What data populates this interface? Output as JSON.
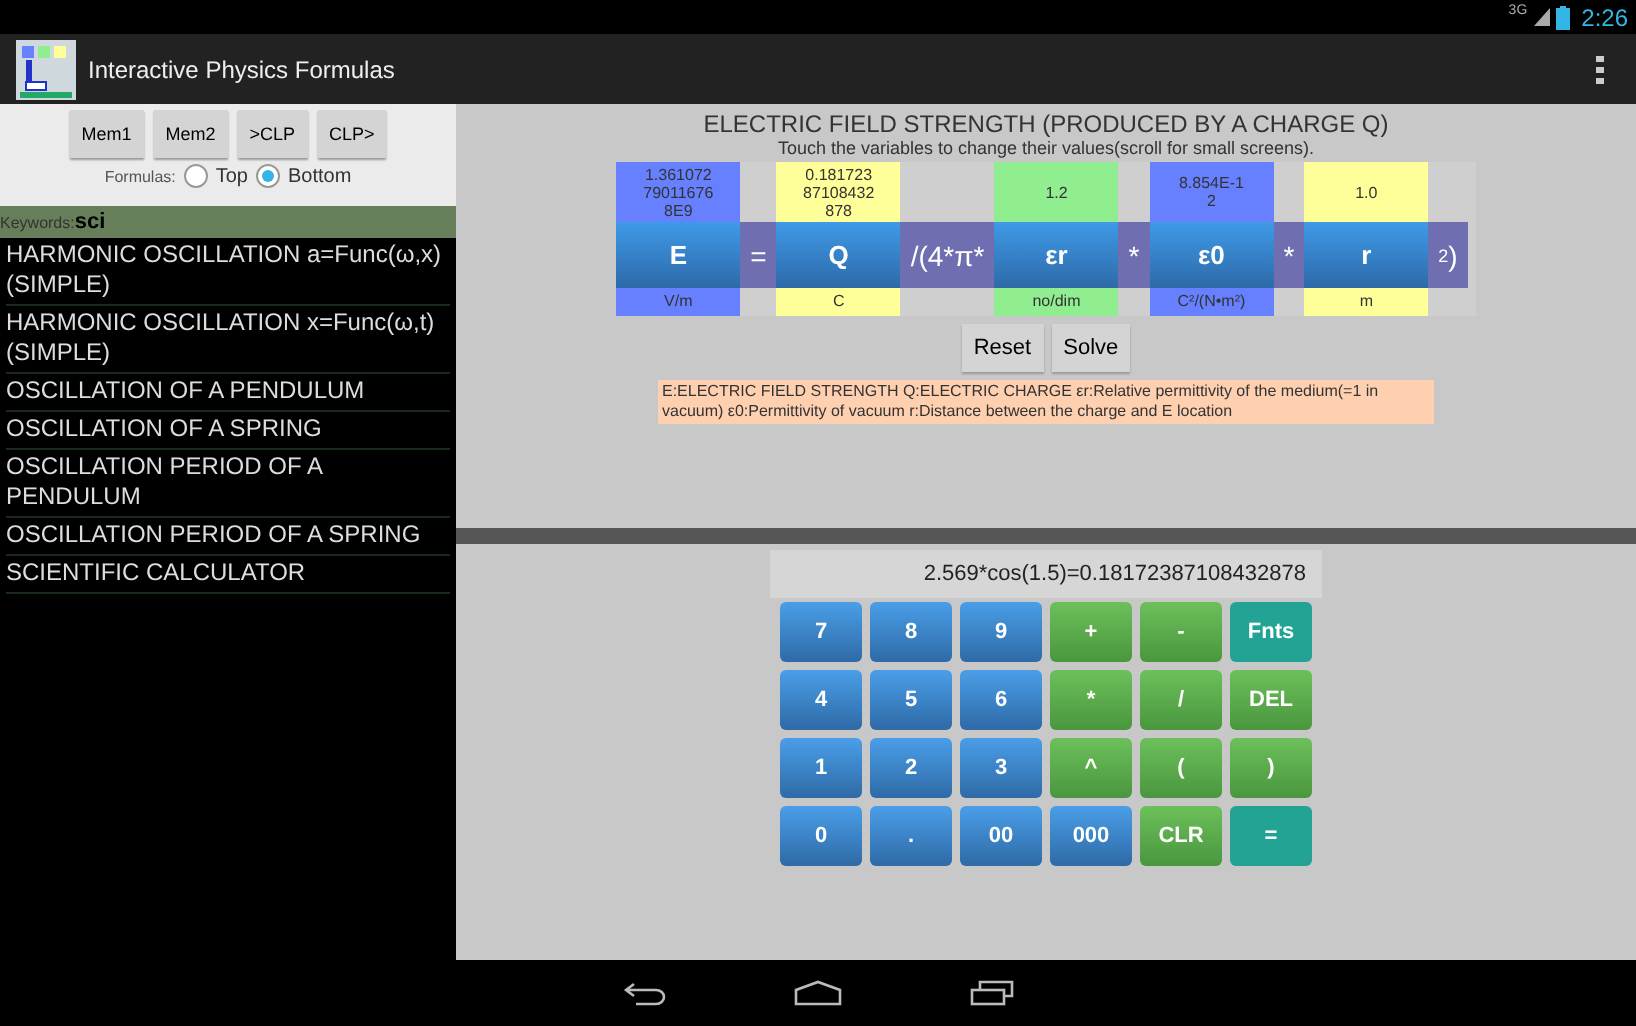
{
  "status_bar": {
    "signal": "3G",
    "time": "2:26"
  },
  "app_bar": {
    "title": "Interactive Physics Formulas"
  },
  "memory_buttons": [
    "Mem1",
    "Mem2",
    ">CLP",
    "CLP>"
  ],
  "formulas_position": {
    "label": "Formulas:",
    "options": [
      {
        "label": "Top",
        "selected": false
      },
      {
        "label": "Bottom",
        "selected": true
      }
    ]
  },
  "keywords": {
    "label": "Keywords:",
    "value": "sci"
  },
  "formula_list": [
    {
      "title": "HARMONIC OSCILLATION a=Func(ω,x) (SIMPLE)"
    },
    {
      "title": "HARMONIC OSCILLATION x=Func(ω,t) (SIMPLE)"
    },
    {
      "title": "OSCILLATION OF A PENDULUM"
    },
    {
      "title": "OSCILLATION OF A SPRING"
    },
    {
      "title": "OSCILLATION PERIOD OF A PENDULUM"
    },
    {
      "title": "OSCILLATION PERIOD OF A SPRING"
    },
    {
      "title": "SCIENTIFIC CALCULATOR"
    }
  ],
  "formula": {
    "title": "ELECTRIC FIELD STRENGTH (PRODUCED BY A CHARGE Q)",
    "hint": "Touch the variables to change their values(scroll for small screens).",
    "terms": [
      {
        "kind": "variable",
        "value": "1.361072 79011676 8E9",
        "symbol": "E",
        "unit": "V/m",
        "color": "#6680ff"
      },
      {
        "kind": "operator",
        "symbol": "="
      },
      {
        "kind": "variable",
        "value": "0.181723 87108432 878",
        "symbol": "Q",
        "unit": "C",
        "color": "#ffff99"
      },
      {
        "kind": "operator",
        "symbol": "/(4*π*"
      },
      {
        "kind": "variable",
        "value": "1.2",
        "symbol": "εr",
        "unit": "no/dim",
        "color": "#90ee90"
      },
      {
        "kind": "operator",
        "symbol": "*"
      },
      {
        "kind": "variable",
        "value": "8.854E-1 2",
        "symbol": "ε0",
        "unit": "C²/(N•m²)",
        "color": "#6680ff"
      },
      {
        "kind": "operator",
        "symbol": "*"
      },
      {
        "kind": "variable",
        "value": "1.0",
        "symbol": "r",
        "unit": "m",
        "color": "#ffff99"
      },
      {
        "kind": "operator",
        "symbol": "$^{2}$)"
      }
    ],
    "buttons": [
      "Reset",
      "Solve"
    ],
    "description": "E:ELECTRIC FIELD STRENGTH  Q:ELECTRIC CHARGE  εr:Relative permittivity of the medium(=1 in vacuum)  ε0:Permittivity of vacuum  r:Distance between the charge and E location"
  },
  "calculator": {
    "display": "2.569*cos(1.5)=0.18172387108432878",
    "keys": [
      {
        "label": "7",
        "kind": "digit"
      },
      {
        "label": "8",
        "kind": "digit"
      },
      {
        "label": "9",
        "kind": "digit"
      },
      {
        "label": "+",
        "kind": "operator"
      },
      {
        "label": "-",
        "kind": "operator"
      },
      {
        "label": "Fnts",
        "kind": "special"
      },
      {
        "label": "4",
        "kind": "digit"
      },
      {
        "label": "5",
        "kind": "digit"
      },
      {
        "label": "6",
        "kind": "digit"
      },
      {
        "label": "*",
        "kind": "operator"
      },
      {
        "label": "/",
        "kind": "operator"
      },
      {
        "label": "DEL",
        "kind": "operator"
      },
      {
        "label": "1",
        "kind": "digit"
      },
      {
        "label": "2",
        "kind": "digit"
      },
      {
        "label": "3",
        "kind": "digit"
      },
      {
        "label": "^",
        "kind": "operator"
      },
      {
        "label": "(",
        "kind": "operator"
      },
      {
        "label": ")",
        "kind": "operator"
      },
      {
        "label": "0",
        "kind": "digit"
      },
      {
        "label": ".",
        "kind": "digit"
      },
      {
        "label": "00",
        "kind": "digit"
      },
      {
        "label": "000",
        "kind": "digit"
      },
      {
        "label": "CLR",
        "kind": "operator"
      },
      {
        "label": "=",
        "kind": "special"
      }
    ]
  }
}
